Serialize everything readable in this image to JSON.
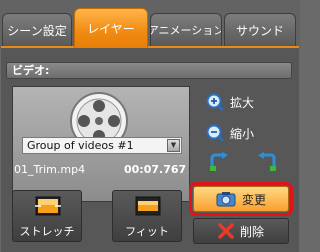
{
  "tabs": [
    {
      "label": "シーン設定",
      "active": false
    },
    {
      "label": "レイヤー",
      "active": true
    },
    {
      "label": "アニメーション",
      "active": false
    },
    {
      "label": "サウンド",
      "active": false
    }
  ],
  "video_section": {
    "header": "ビデオ:",
    "group_select": "Group of videos #1",
    "filename": "01_Trim.mp4",
    "duration": "00:07.767"
  },
  "zoom": {
    "zoom_in_label": "拡大",
    "zoom_out_label": "縮小"
  },
  "buttons": {
    "stretch_label": "ストレッチ",
    "fit_label": "フィット",
    "change_label": "変更",
    "delete_label": "削除"
  },
  "colors": {
    "accent_orange": "#f08a10",
    "highlight_red": "#e2121a",
    "panel_bg": "#575757"
  }
}
